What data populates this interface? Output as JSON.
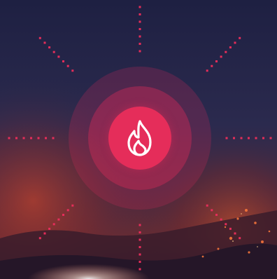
{
  "scene": {
    "background": "wildfire-night-sky",
    "sky_colors": [
      "#1f2140",
      "#2a2a50",
      "#4a2a3c",
      "#6e2a2c"
    ]
  },
  "accent_color": "#e52d5a",
  "fire_button": {
    "icon": "flame-icon",
    "icon_color": "#ffffff"
  },
  "rays": {
    "color": "#e52d5a",
    "count": 8
  }
}
